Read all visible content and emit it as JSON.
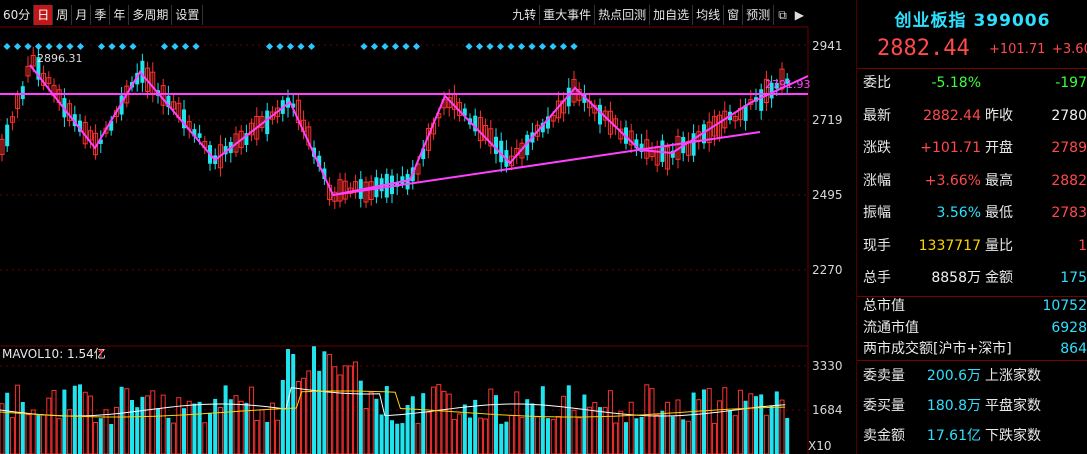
{
  "toolbar": {
    "left_buttons": [
      "60分",
      "日",
      "周",
      "月",
      "季",
      "年",
      "多周期",
      "设置"
    ],
    "active_index": 1,
    "right_buttons": [
      "九转",
      "重大事件",
      "热点回测",
      "加自选",
      "均线",
      "窗",
      "预测"
    ]
  },
  "main_chart": {
    "price_ticks": [
      "2941",
      "2719",
      "2495",
      "2270"
    ],
    "high_marker": "2896.31",
    "right_marker": "2791.93"
  },
  "volume_chart": {
    "label": "MAVOL10: 1.54亿",
    "ticks": [
      "3330",
      "1684"
    ],
    "unit": "X10"
  },
  "quote": {
    "name": "创业板指",
    "code": "399006",
    "price": "2882.44",
    "change": "+101.71",
    "change_pct": "+3.60",
    "rows": [
      {
        "label": "委比",
        "value": "-5.18%",
        "value_color": "green",
        "label2": "",
        "value2": "-197",
        "value2_color": "green"
      },
      {
        "label": "最新",
        "value": "2882.44",
        "value_color": "red",
        "label2": "昨收",
        "value2": "2780",
        "value2_color": "white"
      },
      {
        "label": "涨跌",
        "value": "+101.71",
        "value_color": "red",
        "label2": "开盘",
        "value2": "2789",
        "value2_color": "red"
      },
      {
        "label": "涨幅",
        "value": "+3.66%",
        "value_color": "red",
        "label2": "最高",
        "value2": "2882",
        "value2_color": "red"
      },
      {
        "label": "振幅",
        "value": "3.56%",
        "value_color": "cyan",
        "label2": "最低",
        "value2": "2783",
        "value2_color": "red"
      },
      {
        "label": "现手",
        "value": "1337717",
        "value_color": "yellow",
        "label2": "量比",
        "value2": "1",
        "value2_color": "red"
      },
      {
        "label": "总手",
        "value": "8858万",
        "value_color": "white",
        "label2": "金额",
        "value2": "175",
        "value2_color": "cyan"
      }
    ],
    "market": [
      {
        "label": "总市值",
        "value": "10752"
      },
      {
        "label": "流通市值",
        "value": "6928"
      },
      {
        "label": "两市成交额[沪市+深市]",
        "value": "864"
      }
    ],
    "order": [
      {
        "label": "委卖量",
        "value": "200.6万",
        "label2": "上涨家数"
      },
      {
        "label": "委买量",
        "value": "180.8万",
        "label2": "平盘家数"
      },
      {
        "label": "卖金额",
        "value": "17.61亿",
        "label2": "下跌家数"
      }
    ]
  },
  "colors": {
    "up": "#ff3030",
    "down": "#1fe4ee",
    "pattern_line": "#ff40ff",
    "grid": "#6a0000",
    "diamond": "#28c8ff"
  }
}
